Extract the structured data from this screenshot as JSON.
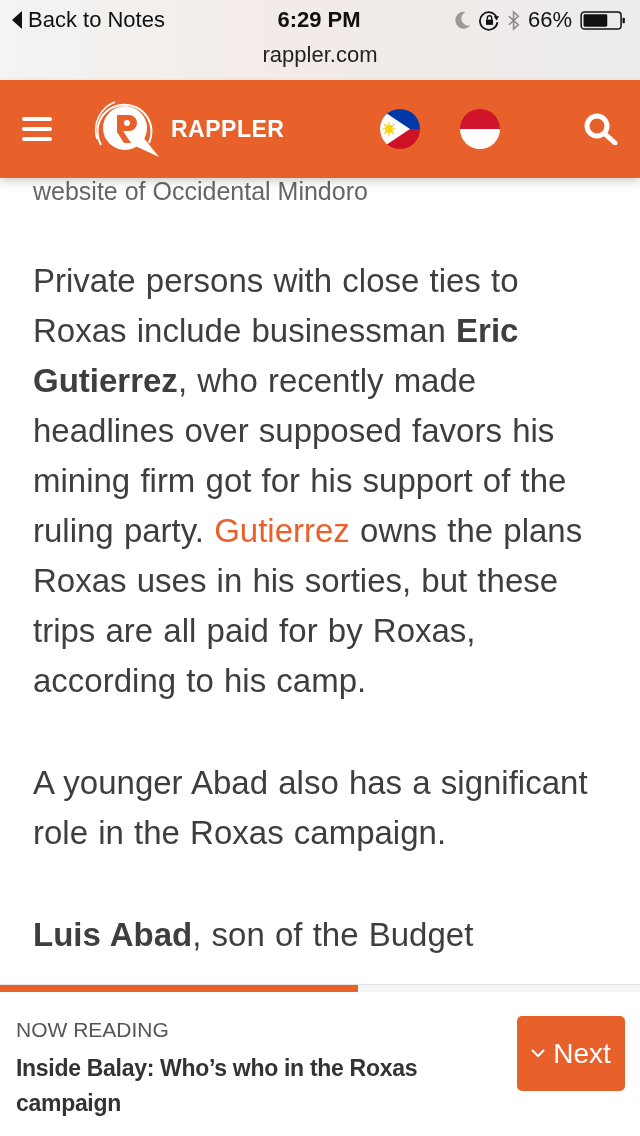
{
  "status_bar": {
    "back_label": "Back to Notes",
    "time": "6:29 PM",
    "battery_text": "66%",
    "url": "rappler.com"
  },
  "header": {
    "brand": "RAPPLER"
  },
  "article": {
    "caption": "website of Occidental Mindoro",
    "paragraphs": [
      [
        {
          "kind": "text",
          "text": "Private persons with close ties to Roxas include businessman **Eric Gutierrez**, who recently made headlines over supposed favors his mining firm got for his support of the ruling party. "
        },
        {
          "kind": "link",
          "text": "Gutierrez"
        },
        {
          "kind": "text",
          "text": " owns the plans Roxas uses in his sorties, but these trips are all paid for by Roxas, according to his camp."
        }
      ],
      [
        {
          "kind": "text",
          "text": "A younger Abad also has a significant role in the Roxas campaign."
        }
      ],
      [
        {
          "kind": "text",
          "text": "**Luis Abad**, son of the Budget"
        }
      ]
    ]
  },
  "reading_bar": {
    "level": 0.56,
    "label": "NOW READING",
    "title": "Inside Balay: Who’s who in the Roxas campaign",
    "next_button": "Next"
  }
}
